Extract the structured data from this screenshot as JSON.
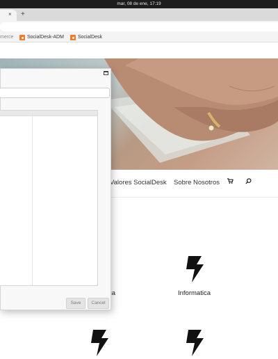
{
  "os": {
    "clock": "mar, 08 de ene, 17:19"
  },
  "browser": {
    "tab_close": "×",
    "new_tab": "+",
    "bookmarks": [
      {
        "label": "merce",
        "favicon": false
      },
      {
        "label": "SocialDesk-ADM",
        "favicon": true
      },
      {
        "label": "SocialDesk",
        "favicon": true
      }
    ]
  },
  "site": {
    "nav": {
      "items": [
        "Valores SocialDesk",
        "Sobre Nosotros"
      ],
      "cart_icon": "cart-icon",
      "search_icon": "search-icon"
    },
    "services": [
      {
        "label": "ca",
        "icon": "lightning-icon"
      },
      {
        "label": "Informatica",
        "icon": "lightning-icon"
      },
      {
        "label": "",
        "icon": "lightning-icon"
      },
      {
        "label": "",
        "icon": "lightning-icon"
      }
    ]
  },
  "dialog": {
    "input_value": "",
    "save_label": "Save",
    "cancel_label": "Cancel"
  },
  "colors": {
    "bookmark_favicon": "#f17b2c",
    "icon_dark": "#111111"
  }
}
